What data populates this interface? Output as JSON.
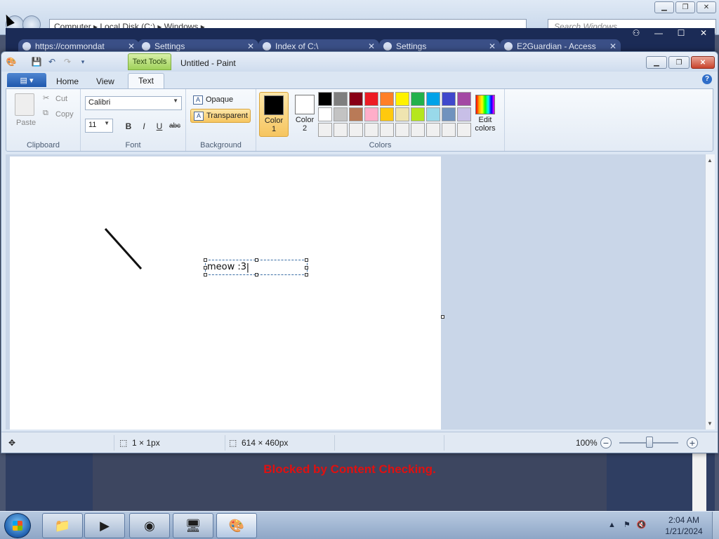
{
  "explorer": {
    "address": "Computer ▸ Local Disk (C:) ▸ Windows ▸",
    "search_placeholder": "Search Windows"
  },
  "browser": {
    "tabs": [
      {
        "label": "https://commondat"
      },
      {
        "label": "Settings"
      },
      {
        "label": "Index of C:\\"
      },
      {
        "label": "Settings"
      },
      {
        "label": "E2Guardian - Access"
      }
    ],
    "blocked_message": "Blocked by Content Checking."
  },
  "paint": {
    "title": "Untitled - Paint",
    "contextual_tab": "Text Tools",
    "ribbon_tabs": {
      "home": "Home",
      "view": "View",
      "text": "Text"
    },
    "clipboard": {
      "paste": "Paste",
      "cut": "Cut",
      "copy": "Copy",
      "group_label": "Clipboard"
    },
    "font": {
      "family": "Calibri",
      "size": "11",
      "bold": "B",
      "italic": "I",
      "underline": "U",
      "strike": "abc",
      "group_label": "Font"
    },
    "background": {
      "opaque": "Opaque",
      "transparent": "Transparent",
      "selected": "transparent",
      "group_label": "Background"
    },
    "colors": {
      "color1_label": "Color 1",
      "color1_value": "#000000",
      "color2_label": "Color 2",
      "color2_value": "#ffffff",
      "edit_label": "Edit colors",
      "group_label": "Colors",
      "palette": [
        "#000000",
        "#7f7f7f",
        "#880015",
        "#ed1c24",
        "#ff7f27",
        "#fff200",
        "#22b14c",
        "#00a2e8",
        "#3f48cc",
        "#a349a4",
        "#ffffff",
        "#c3c3c3",
        "#b97a57",
        "#ffaec9",
        "#ffc90e",
        "#efe4b0",
        "#b5e61d",
        "#99d9ea",
        "#7092be",
        "#c8bfe7",
        "#f0f0f0",
        "#f0f0f0",
        "#f0f0f0",
        "#f0f0f0",
        "#f0f0f0",
        "#f0f0f0",
        "#f0f0f0",
        "#f0f0f0",
        "#f0f0f0",
        "#f0f0f0"
      ]
    },
    "canvas_text": "meow :3",
    "status": {
      "selection": "1 × 1px",
      "image_size": "614 × 460px",
      "zoom": "100%"
    }
  },
  "taskbar": {
    "clock_time": "2:04 AM",
    "clock_date": "1/21/2024"
  }
}
